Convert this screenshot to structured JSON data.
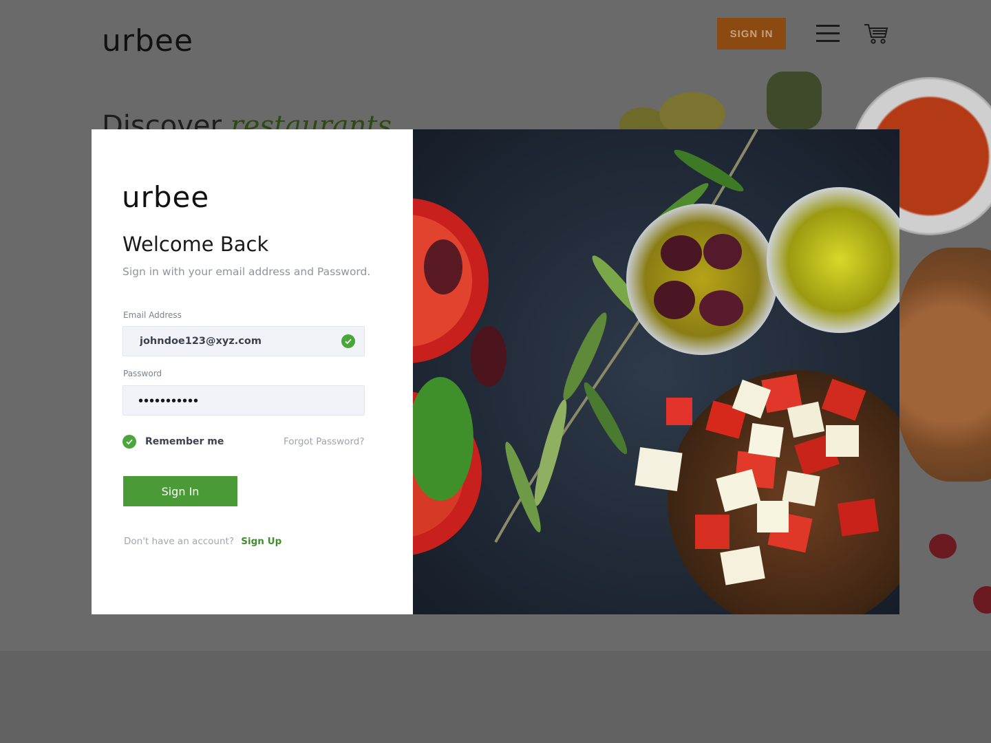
{
  "background_page": {
    "logo": "urbee",
    "signin_label": "SIGN IN",
    "headline_word1": "Discover",
    "headline_word2": "restaurants",
    "menu_icon": "hamburger-menu-icon",
    "cart_icon": "cart-icon"
  },
  "modal": {
    "logo": "urbee",
    "title": "Welcome Back",
    "subtitle": "Sign in with your email address and Password.",
    "email": {
      "label": "Email Address",
      "value": "johndoe123@xyz.com",
      "valid_icon": "check-circle-icon"
    },
    "password": {
      "label": "Password",
      "masked_value": "•••••••••••"
    },
    "remember_label": "Remember me",
    "remember_checked": true,
    "forgot_label": "Forgot Password?",
    "signin_label": "Sign In",
    "no_account_text": "Don't have an account?",
    "signup_label": "Sign Up"
  },
  "colors": {
    "accent_green": "#4a9a38",
    "orange_button": "#8a4a12",
    "overlay": "#6a6a6a"
  }
}
